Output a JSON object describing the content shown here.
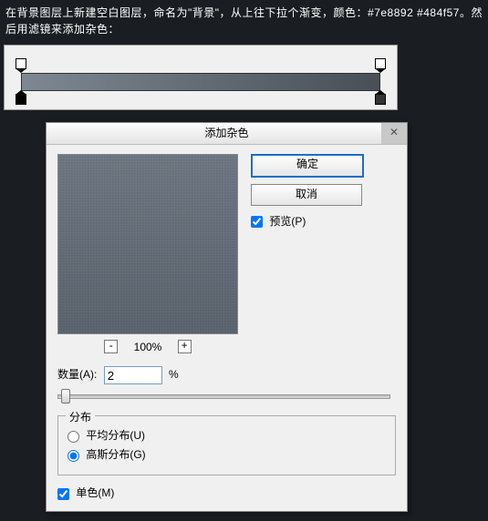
{
  "instructions": "在背景图层上新建空白图层，命名为\"背景\"，从上往下拉个渐变，颜色：#7e8892 #484f57。然后用滤镜来添加杂色：",
  "dialog": {
    "title": "添加杂色",
    "ok": "确定",
    "cancel": "取消",
    "preview_label": "预览(P)",
    "preview_checked": true,
    "zoom": "100%",
    "amount_label": "数量(A):",
    "amount_value": "2",
    "amount_unit": "%",
    "dist_legend": "分布",
    "dist_uniform": "平均分布(U)",
    "dist_gaussian": "高斯分布(G)",
    "dist_selected": "gaussian",
    "mono_label": "单色(M)",
    "mono_checked": true
  },
  "colors": {
    "gradient_start": "#7e8892",
    "gradient_end": "#484f57"
  }
}
